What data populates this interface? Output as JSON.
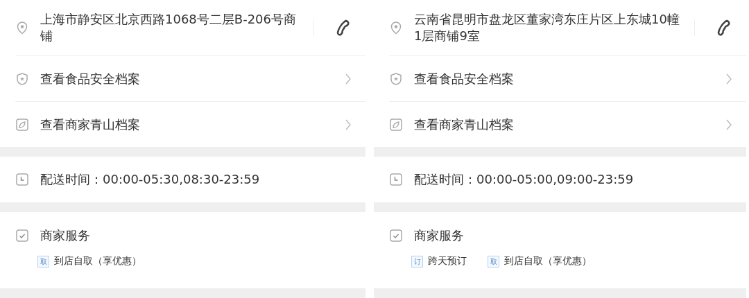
{
  "panels": [
    {
      "address": "上海市静安区北京西路1068号二层B-206号商铺",
      "links": [
        "查看食品安全档案",
        "查看商家青山档案"
      ],
      "delivery": "配送时间：00:00-05:30,08:30-23:59",
      "services": {
        "title": "商家服务",
        "tags": [
          {
            "badge": "取",
            "label": "到店自取（享优惠）"
          }
        ]
      }
    },
    {
      "address": "云南省昆明市盘龙区董家湾东庄片区上东城10幢1层商铺9室",
      "links": [
        "查看食品安全档案",
        "查看商家青山档案"
      ],
      "delivery": "配送时间：00:00-05:00,09:00-23:59",
      "services": {
        "title": "商家服务",
        "tags": [
          {
            "badge": "订",
            "label": "跨天预订"
          },
          {
            "badge": "取",
            "label": "到店自取（享优惠）"
          }
        ]
      }
    }
  ]
}
